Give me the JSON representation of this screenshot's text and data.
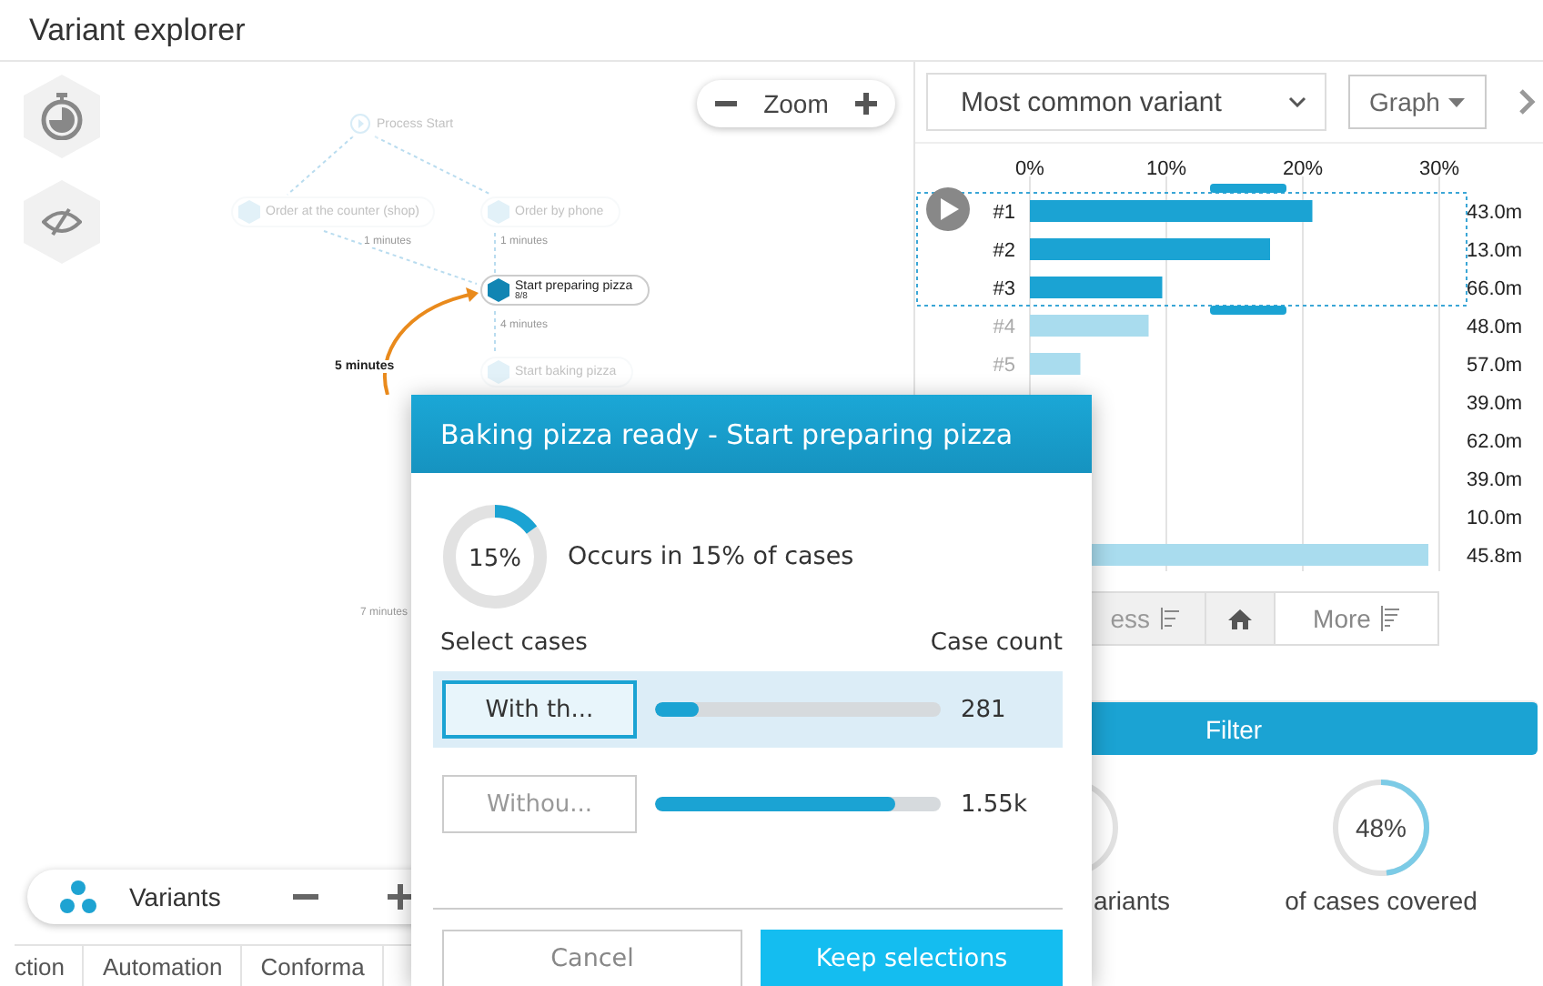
{
  "window": {
    "title": "Variant explorer"
  },
  "canvas": {
    "zoom_label": "Zoom",
    "nodes": [
      {
        "label": "Process Start",
        "kind": "start",
        "selected": false
      },
      {
        "label": "Order at the counter (shop)",
        "kind": "activity",
        "selected": false
      },
      {
        "label": "Order by phone",
        "kind": "activity",
        "selected": false
      },
      {
        "label": "Start preparing pizza",
        "kind": "activity",
        "selected": true,
        "count": "8/8"
      },
      {
        "label": "Start baking pizza",
        "kind": "activity",
        "selected": false
      }
    ],
    "edge_labels": [
      {
        "text": "1 minutes",
        "selected": false
      },
      {
        "text": "1 minutes",
        "selected": false
      },
      {
        "text": "4 minutes",
        "selected": false
      },
      {
        "text": "5 minutes",
        "selected": true
      },
      {
        "text": "7 minutes",
        "selected": false
      }
    ],
    "variants_bar": {
      "label": "Variants"
    }
  },
  "bottom_tabs": [
    {
      "label": "ction"
    },
    {
      "label": "Automation"
    },
    {
      "label": "Conforma"
    }
  ],
  "right_panel": {
    "variant_dropdown": {
      "value": "Most common variant"
    },
    "view_button": {
      "label": "Graph"
    },
    "chart_data": {
      "type": "bar",
      "orientation": "horizontal",
      "values": [
        20.7,
        17.6,
        9.7,
        8.7,
        3.7,
        null,
        null,
        null,
        null,
        29.2
      ],
      "xlim": [
        0,
        30
      ],
      "xticks": [
        {
          "value": 0,
          "label": "0%"
        },
        {
          "value": 10,
          "label": "10%"
        },
        {
          "value": 20,
          "label": "20%"
        },
        {
          "value": 30,
          "label": "30%"
        }
      ]
    },
    "rows": [
      {
        "label": "#1",
        "duration": "43.0m",
        "selected": true
      },
      {
        "label": "#2",
        "duration": "13.0m",
        "selected": true
      },
      {
        "label": "#3",
        "duration": "66.0m",
        "selected": true
      },
      {
        "label": "#4",
        "duration": "48.0m",
        "selected": false
      },
      {
        "label": "#5",
        "duration": "57.0m",
        "selected": false
      },
      {
        "duration": "39.0m"
      },
      {
        "duration": "62.0m"
      },
      {
        "duration": "39.0m"
      },
      {
        "duration": "10.0m"
      },
      {
        "duration": "45.8m",
        "selected": false
      }
    ],
    "less_button": {
      "label": "ess"
    },
    "more_button": {
      "label": "More"
    },
    "filter_button": {
      "label": "Filter"
    },
    "stats": [
      {
        "label": "ariants"
      },
      {
        "reading": "48%",
        "level": 0.48,
        "label": "of cases covered"
      }
    ]
  },
  "dialog": {
    "title": "Baking pizza ready - Start preparing pizza",
    "share": {
      "reading": "15%",
      "level": 0.15,
      "text": "Occurs in 15% of cases"
    },
    "select_label": "Select cases",
    "count_label": "Case count",
    "options": [
      {
        "label": "With th...",
        "level": 0.15,
        "count": "281",
        "selected": true
      },
      {
        "label": "Withou...",
        "level": 0.84,
        "count": "1.55k",
        "selected": false
      }
    ],
    "cancel_button": {
      "label": "Cancel"
    },
    "confirm_button": {
      "label": "Keep selections"
    }
  }
}
